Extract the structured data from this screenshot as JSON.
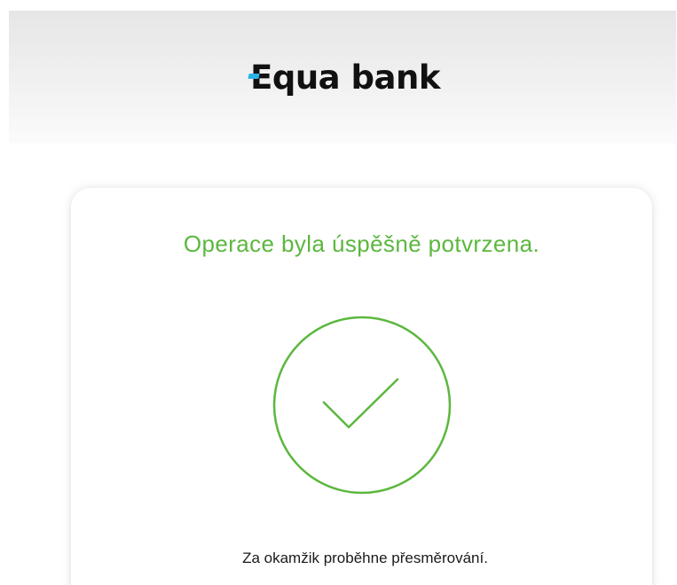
{
  "header": {
    "logo": {
      "first_letter": "E",
      "rest": "qua bank",
      "accent_color": "#2bb1e6"
    }
  },
  "card": {
    "title": "Operace byla úspěšně potvrzena.",
    "status_icon": "check-circle-icon",
    "success_color": "#5cb73f",
    "redirect_message": "Za okamžik proběhne přesměrování."
  }
}
